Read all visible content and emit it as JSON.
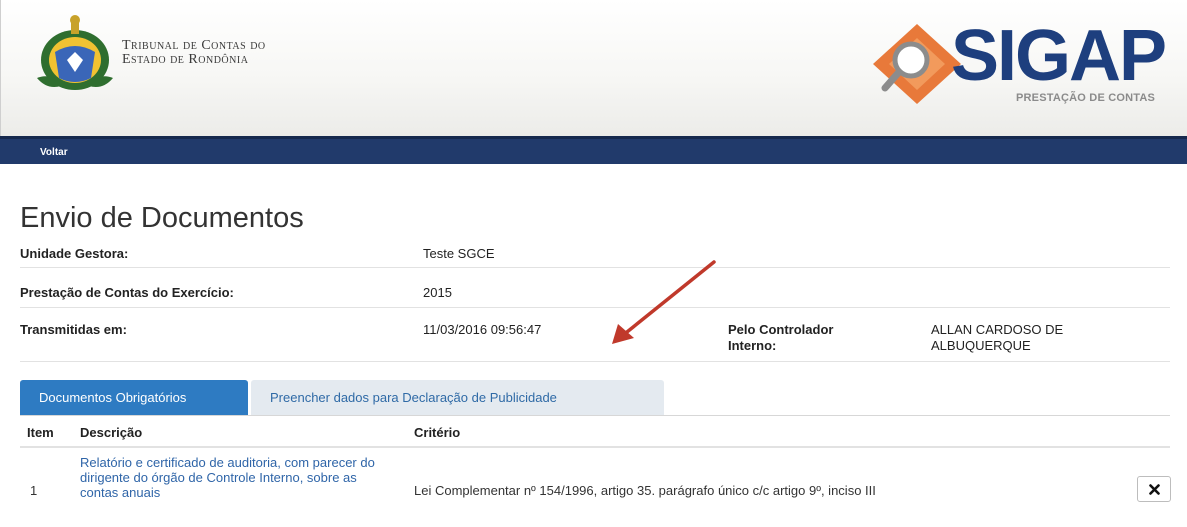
{
  "header": {
    "org_line1": "Tribunal de Contas do",
    "org_line2": "Estado de Rondônia",
    "logo_text": "SIGAP",
    "logo_subtitle": "PRESTAÇÃO DE CONTAS"
  },
  "nav": {
    "back_label": "Voltar"
  },
  "page": {
    "title": "Envio de Documentos"
  },
  "info": {
    "unidade_label": "Unidade Gestora:",
    "unidade_value": "Teste SGCE",
    "exercicio_label": "Prestação de Contas do Exercício:",
    "exercicio_value": "2015",
    "transmitidas_label": "Transmitidas em:",
    "transmitidas_value": "11/03/2016 09:56:47",
    "controlador_label_1": "Pelo Controlador",
    "controlador_label_2": "Interno:",
    "controlador_value_1": "ALLAN CARDOSO DE",
    "controlador_value_2": "ALBUQUERQUE"
  },
  "tabs": [
    {
      "label": "Documentos Obrigatórios",
      "active": true
    },
    {
      "label": "Preencher dados para Declaração de Publicidade",
      "active": false
    }
  ],
  "table": {
    "headers": {
      "item": "Item",
      "descricao": "Descrição",
      "criterio": "Critério"
    },
    "rows": [
      {
        "item": "1",
        "descricao": "Relatório e certificado de auditoria, com parecer do dirigente do órgão de Controle Interno, sobre as contas anuais",
        "criterio": "Lei Complementar nº 154/1996, artigo 35. parágrafo único c/c artigo 9º, inciso III"
      }
    ]
  },
  "colors": {
    "navbar": "#213a6b",
    "active_tab": "#2e7bc2",
    "link": "#2f65a8",
    "logo_blue": "#1e3f7e",
    "logo_orange": "#e8793a",
    "arrow": "#c0392b"
  },
  "icons": {
    "crest": "coat-of-arms-icon",
    "logo": "magnifier-diamond-logo-icon",
    "delete": "close-icon"
  }
}
